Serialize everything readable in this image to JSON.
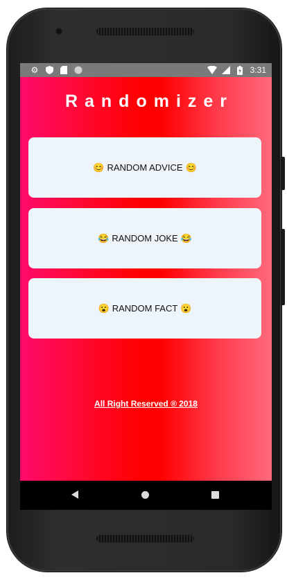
{
  "status_bar": {
    "time": "3:31",
    "left_icons": [
      "gear-icon",
      "shield-icon",
      "sd-card-icon",
      "circle-icon"
    ],
    "right_icons": [
      "wifi-icon",
      "signal-icon",
      "battery-icon"
    ]
  },
  "app": {
    "title": "Randomizer",
    "colors": {
      "gradient_left": "#ff0a6c",
      "gradient_mid": "#ff0000",
      "gradient_right": "#ff6a7c",
      "card_bg": "#edf4fa"
    },
    "buttons": [
      {
        "emoji": "😊",
        "label": "RANDOM ADVICE"
      },
      {
        "emoji": "😂",
        "label": "RANDOM JOKE"
      },
      {
        "emoji": "😮",
        "label": "RANDOM FACT"
      }
    ],
    "footer": "All Right Reserved ® 2018"
  },
  "nav_bar": {
    "icons": [
      "back-icon",
      "home-icon",
      "recents-icon"
    ]
  }
}
